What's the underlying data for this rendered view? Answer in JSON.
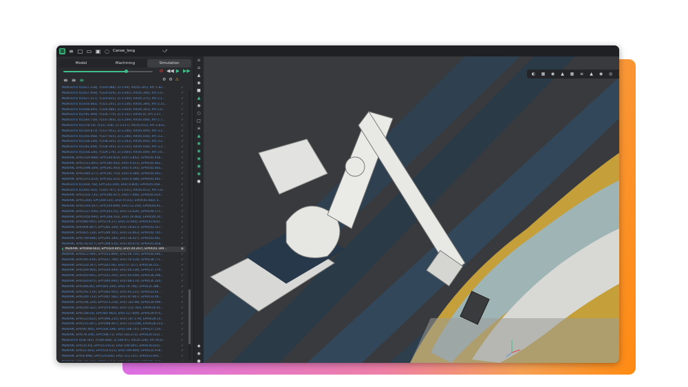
{
  "window": {
    "title": "Canoe_long"
  },
  "tabs": [
    {
      "label": "Model"
    },
    {
      "label": "Machining"
    },
    {
      "label": "Simulation"
    }
  ],
  "simulation": {
    "progress": 0.7
  },
  "icons": {
    "app": "app-logo-icon",
    "menu": "menu-icon",
    "new": "new-file-icon",
    "open": "folder-icon",
    "save": "save-icon",
    "share": "share-icon"
  },
  "colors": {
    "accent": "#3ec08a",
    "command_text": "#5f8fce",
    "gradient_start": "#d96cf0",
    "gradient_end": "#ff8a10"
  },
  "commands": [
    {
      "text": "MultiGOTO X(1617.228), Y(320.088), Z(-3.94), RX(45.345), RY(-1.82..."
    },
    {
      "text": "MultiGOTO X(1617.958), Y(320.629), Z(-3.945), RX(45.366), RY(-2.0..."
    },
    {
      "text": "MultiGOTO X(1617.217), Y(320.815), Z(-3.549), RX(45.375), RY(-2.1..."
    },
    {
      "text": "MultiGOTO X(1616.681), Y(321.201), Z(-3.536), RX(45.384), RY(-2.31..."
    },
    {
      "text": "MultiGOTO X(1608.045), Y(326.486), Z(-3.924), RX(45.363), RY(-2.6..."
    },
    {
      "text": "MultiGOTO X(1591.409), Y(334.774), Z(-3.151), RX(45.4), RY(-2.57..."
    },
    {
      "text": "MultiGOTO X(1564.718), Y(337.064), Z(-3.209), RX(45.408), RY(-2.7..."
    },
    {
      "text": "MultiGOTO X(1578.14), Y(337.258), Z(-3.217), RX(45.413), RY(-2.833..."
    },
    {
      "text": "MultiGOTO X(1564.873), Y(337.952), Z(-3.246), RX(45.409), RY(-3.1..."
    },
    {
      "text": "MultiGOTO X(1556.068), Y(337.935), Z(-3.286), RX(45.436), RY(-3.2..."
    },
    {
      "text": "MultiGOTO X(1538.236), Y(338.205), Z(-3.263), RX(45.444), RY(-3.2..."
    },
    {
      "text": "MultiGOTO X(1561.644), Y(338.305), Z(-3.535), RX(45.436), RY(-3.3..."
    },
    {
      "text": "MultiGOTO X(1558.336), Y(329.176), Z(-3.664), RX(45.449), RY(-3.6..."
    },
    {
      "text": "MultiARC EPX(1526.868), EPY(339.824), EPZ(-3.842), EPRX(45.456..."
    },
    {
      "text": "MultiARC EPX(1511.805), EPY(340.442), EPZ(-4.011), EPRX(45.462..."
    },
    {
      "text": "MultiARC EPX(1498.309), EPY(341.093), EPZ(-4.191), EPRX(45.465..."
    },
    {
      "text": "MultiARC EPX(1485.277), EPY(341.753), EPZ(-4.384), EPRX(45.463..."
    },
    {
      "text": "MultiARC EPX(1472.014), EPY(342.421), EPZ(-4.588), EPRX(45.461..."
    },
    {
      "text": "MultiGOTO X(1458.758), EPY(343.109), EPZ(-4.804), EPRX(45.458..."
    },
    {
      "text": "MultiGOTO X(1445.501), Y(343.797), Z(-5.031), RX(45.453), RY(-5.8..."
    },
    {
      "text": "MultiARC EPX(1432.735), EPY(346.927), EPZ(-7.066), EPRX(45.624..."
    },
    {
      "text": "MultiARC EPX(1260), EPY(304.535), EPZ(-9.555), EPRX(45.083), E..."
    },
    {
      "text": "MultiARC EPX(1193.507), EPY(259.899), EPZ(-12.356), EPRX(44.91..."
    },
    {
      "text": "MultiARC EPX(1127.056), EPY(263.55), EPZ(-15.626), EPRX(44.571..."
    },
    {
      "text": "MultiARC EPX(1050.994), EPY(268.162), EPZ(-19.483), EPRX(44.20..."
    },
    {
      "text": "MultiARC EPX(980.905), EPY(279.37), EPZ(-23.694), EPRX(43.835)..."
    },
    {
      "text": "MultiARC EPX(904.807), EPY(282.339), EPZ(-28.613), EPRX(43.357..."
    },
    {
      "text": "MultiARC EPX(825.128), EPY(289.165), EPZ(-33.663), EPRX(42.765..."
    },
    {
      "text": "MultiARC EPX(749.648), EPY(293.184), EPZ(-36.937), EPRX(42.46)..."
    },
    {
      "text": "MultiARC EPX(742.877), EPY(398.535), EPZ(-40.675), EPRX(41.858..."
    },
    {
      "text": "MultiARC EPX(668.603), EPY(424.605), EPZ(-44.267), EPRX(41.189...",
      "active": true
    },
    {
      "text": "MultiARC EPX(623.949), EPY(413.869), EPZ(-48.716), EPRX(40.066..."
    },
    {
      "text": "MultiARC EPX(585.436), EPY(417.789), EPZ(-50.518), EPRX(38.771..."
    },
    {
      "text": "MultiARC EPX(520.297), EPY(425.06), EPZ(-57.317), EPRX(38.215..."
    },
    {
      "text": "MultiARC EPX(509.904), EPY(429.449), EPZ(-60.138), EPRX(37.279..."
    },
    {
      "text": "MultiARC EPX(450.901), EPY(435.205), EPZ(-64.449), EPRX(36.298..."
    },
    {
      "text": "MultiARC EPX(420.875), EPY(440.094), EPZ(-68.574), EPRX(35.324..."
    },
    {
      "text": "MultiARC EPX(366.85), EPY(441.244), EPZ(-79.706), EPRX(35.388..."
    },
    {
      "text": "MultiARC EPX(292.119), EPY(462.005), EPZ(-92.231), EPRX(33.42..."
    },
    {
      "text": "MultiARC EPX(240.713), EPY(467.582), EPZ(-97.667), EPRX(33.40..."
    },
    {
      "text": "MultiARC EPX(194.229), EPY(473.218), EPZ(-102.98), EPRX(30.999..."
    },
    {
      "text": "MultiARC EPX(209.322), EPY(479.466), EPZ(-112.782), EPRX(30.61..."
    },
    {
      "text": "MultiARC EPX(148.03), EPY(487.863), EPZ(-127.609), EPRX(29.974..."
    },
    {
      "text": "MultiARC EPX(123.812), EPY(496.235), EPZ(-147.179), EPRX(28.54..."
    },
    {
      "text": "MultiARC EPX(115.007), EPY(498.467), EPZ(-153.108), EPRX(28.313..."
    },
    {
      "text": "MultiARC EPX(90.465), EPY(504.198), EPZ(-168.747), EPRX(27.514..."
    },
    {
      "text": "MultiARC EPX(78.194), EPY(508.71), EPZ(-182.273), EPRX(26.552)..."
    },
    {
      "text": "MultiGOTO X(58.785), Y(509.668), Z(-184.97), RX(26.328), RY(-95.8..."
    },
    {
      "text": "MultiARC EPX(35.93), EPY(513.923), EPZ(-196.695), EPRX(26.025)..."
    },
    {
      "text": "MultiARC EPX(21.641), EPY(514.613), EPZ(-199.969), EPRX(25.978..."
    },
    {
      "text": "MultiARC EPX(6.898), EPY(519.836), EPZ(-213.125), EPRX(25.695..."
    },
    {
      "text": "MultiARC EPX(-20.325), EPY(523.62), EPZ(-225.618), EPRX(45.323)..."
    }
  ]
}
